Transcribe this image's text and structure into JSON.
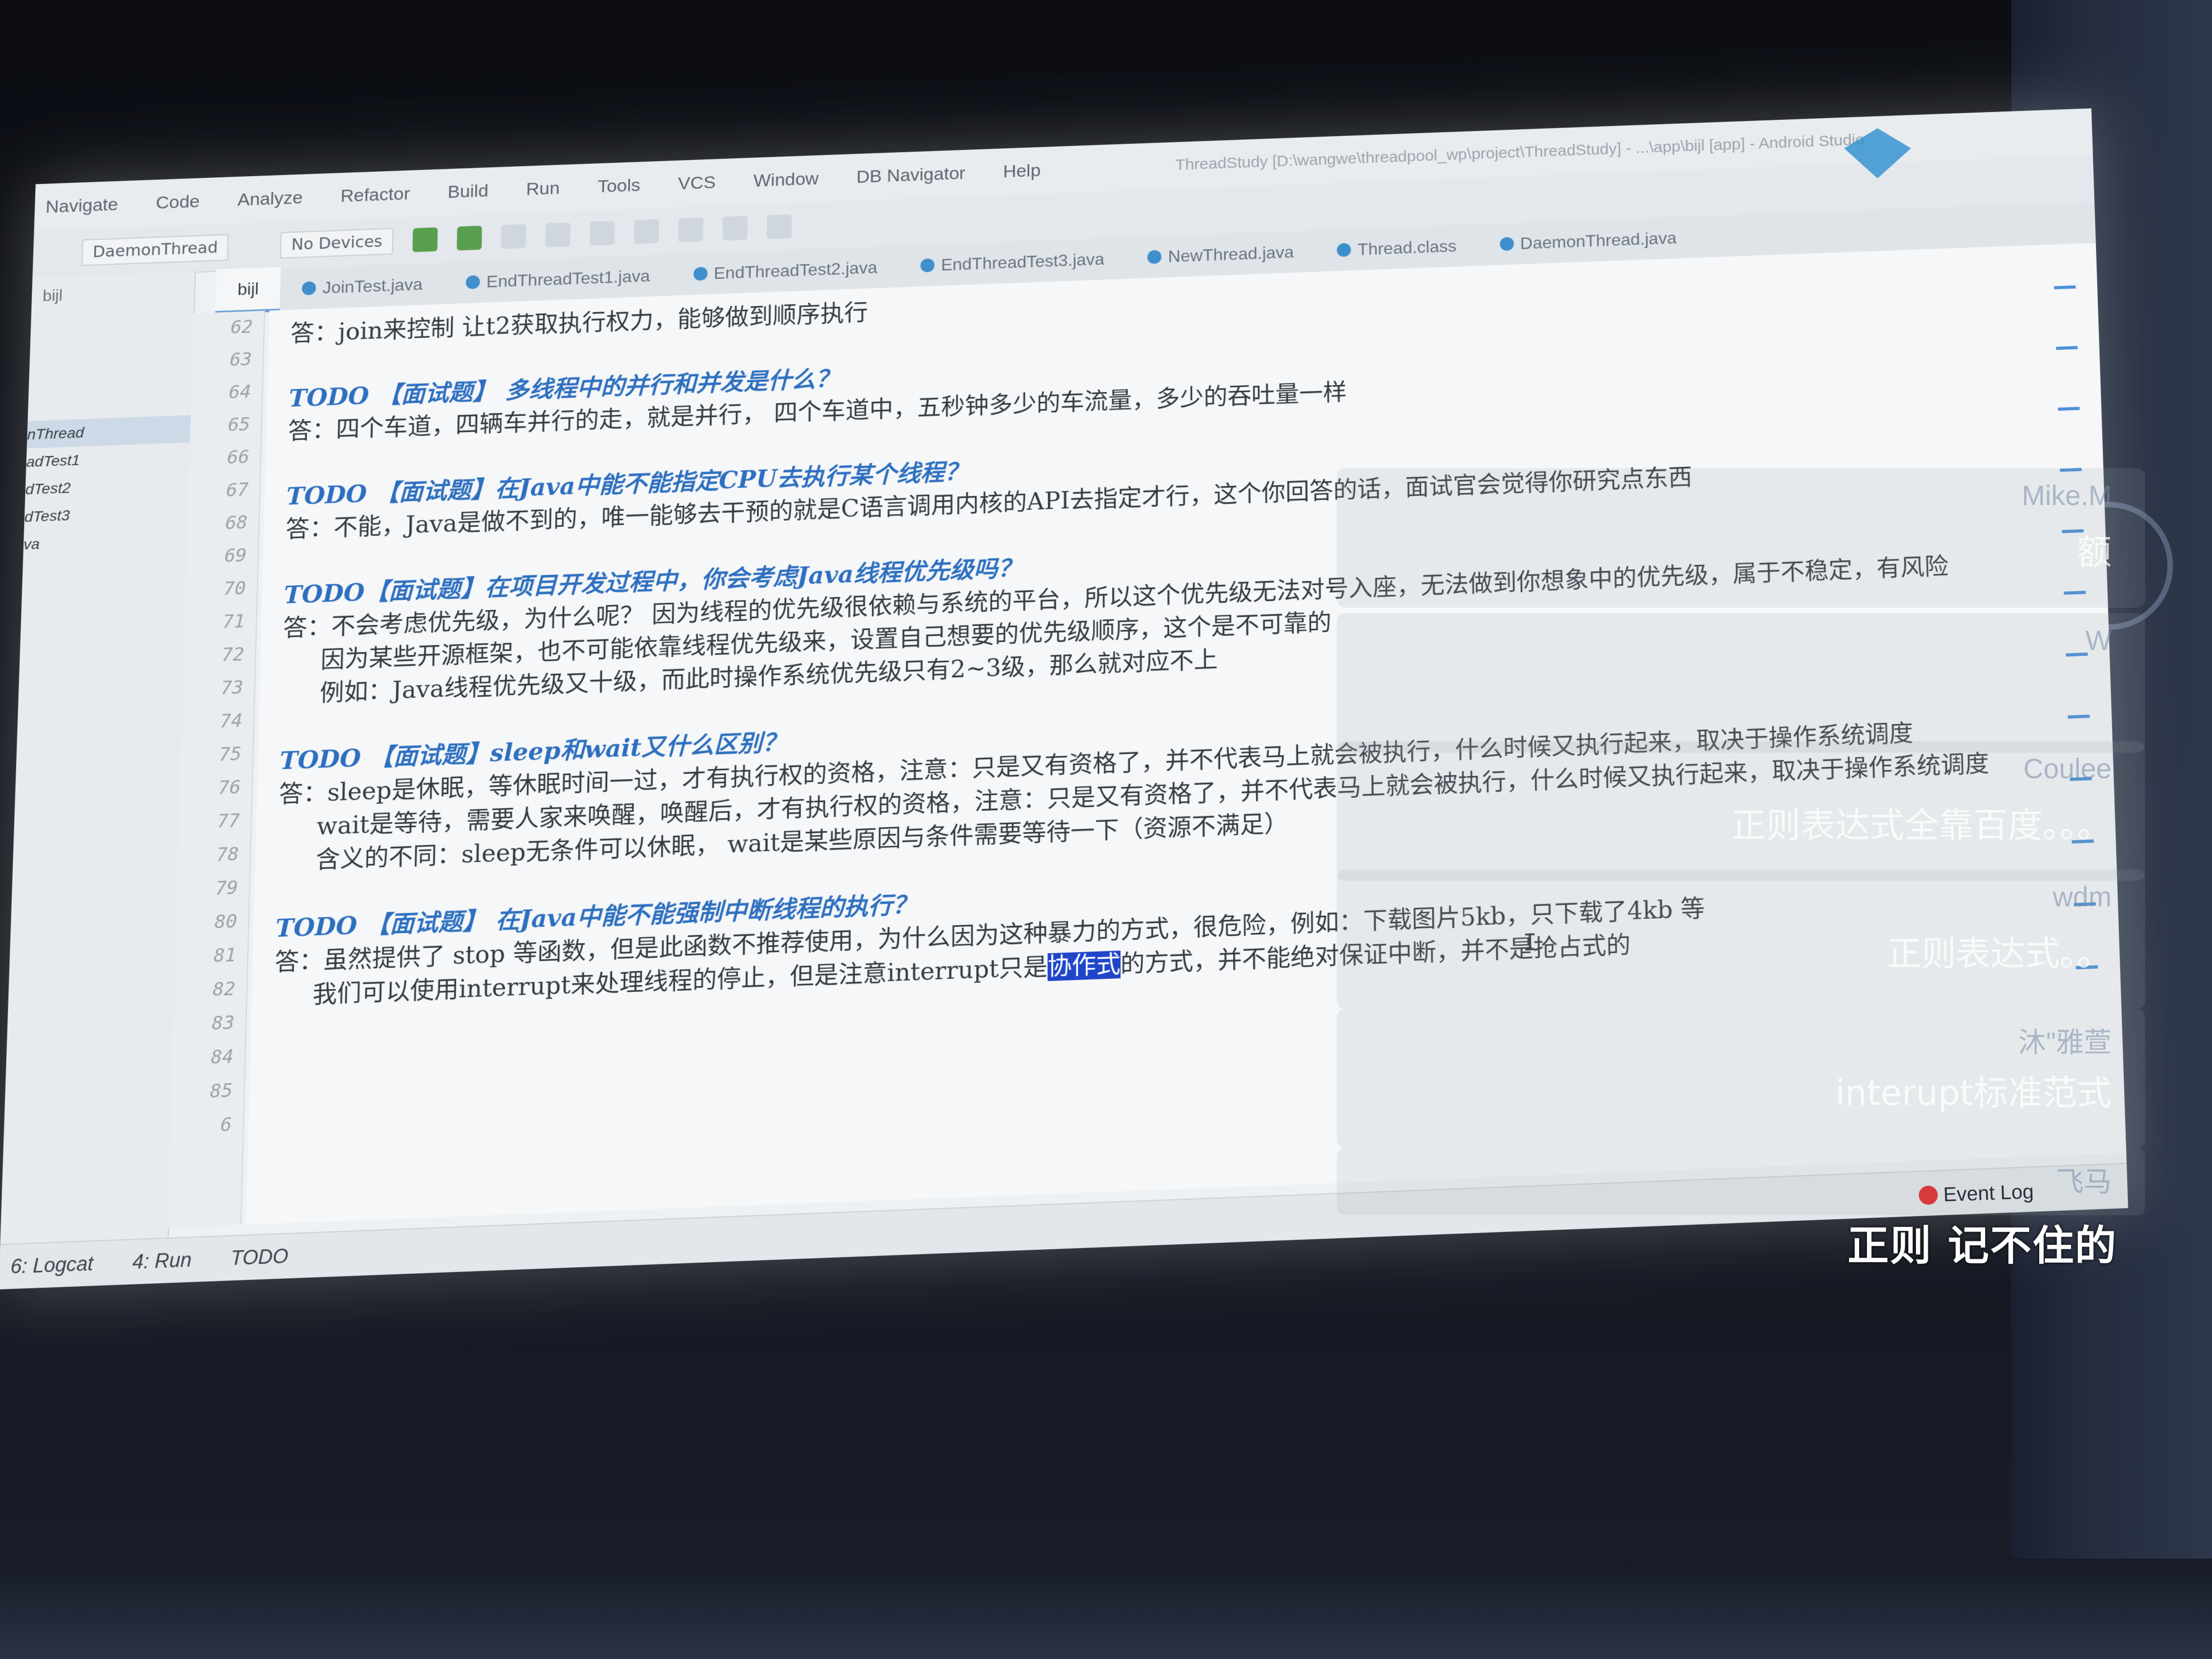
{
  "window": {
    "title": "ThreadStudy [D:\\wangwe\\threadpool_wp\\project\\ThreadStudy] - ...\\app\\bijl [app] - Android Studio"
  },
  "menu": [
    "Navigate",
    "Code",
    "Analyze",
    "Refactor",
    "Build",
    "Run",
    "Tools",
    "VCS",
    "Window",
    "DB Navigator",
    "Help"
  ],
  "toolbar": {
    "run_config": "DaemonThread",
    "devices": "No Devices"
  },
  "tabs": [
    {
      "label": "bijl",
      "active": true
    },
    {
      "label": "JoinTest.java"
    },
    {
      "label": "EndThreadTest1.java"
    },
    {
      "label": "EndThreadTest2.java"
    },
    {
      "label": "EndThreadTest3.java"
    },
    {
      "label": "NewThread.java"
    },
    {
      "label": "Thread.class"
    },
    {
      "label": "DaemonThread.java"
    }
  ],
  "project_panel": {
    "header": "bijl",
    "items": [
      "nThread",
      "adTest1",
      "dTest2",
      "dTest3",
      "va"
    ]
  },
  "editor": {
    "line_numbers": [
      "62",
      "63",
      "64",
      "65",
      "66",
      "67",
      "68",
      "69",
      "70",
      "71",
      "72",
      "73",
      "74",
      "75",
      "76",
      "77",
      "78",
      "79",
      "80",
      "81",
      "82",
      "83",
      "84",
      "85",
      "6"
    ],
    "lines": [
      {
        "ln": "62",
        "text": "答：join来控制 让t2获取执行权力，能够做到顺序执行"
      },
      {
        "ln": "64",
        "todo": "TODO 【面试题】 多线程中的并行和并发是什么？"
      },
      {
        "ln": "65",
        "text": "答：四个车道，四辆车并行的走，就是并行，     四个车道中，五秒钟多少的车流量，多少的吞吐量一样"
      },
      {
        "ln": "67",
        "todo": "TODO 【面试题】在Java中能不能指定CPU去执行某个线程？"
      },
      {
        "ln": "68",
        "text": "答：不能，Java是做不到的，唯一能够去干预的就是C语言调用内核的API去指定才行，这个你回答的话，面试官会觉得你研究点东西"
      },
      {
        "ln": "70",
        "todo": "TODO【面试题】在项目开发过程中，你会考虑Java线程优先级吗？"
      },
      {
        "ln": "71",
        "text": "答：不会考虑优先级，为什么呢？ 因为线程的优先级很依赖与系统的平台，所以这个优先级无法对号入座，无法做到你想象中的优先级，属于不稳定，有风险"
      },
      {
        "ln": "72",
        "text": "因为某些开源框架，也不可能依靠线程优先级来，设置自己想要的优先级顺序，这个是不可靠的"
      },
      {
        "ln": "73",
        "text": "例如：Java线程优先级又十级，而此时操作系统优先级只有2~3级，那么就对应不上"
      },
      {
        "ln": "75",
        "todo": "TODO 【面试题】sleep和wait又什么区别？"
      },
      {
        "ln": "76",
        "text": "答：sleep是休眠，等休眠时间一过，才有执行权的资格，注意：只是又有资格了，并不代表马上就会被执行，什么时候又执行起来，取决于操作系统调度"
      },
      {
        "ln": "77",
        "text": "wait是等待，需要人家来唤醒，唤醒后，才有执行权的资格，注意：只是又有资格了，并不代表马上就会被执行，什么时候又执行起来，取决于操作系统调度"
      },
      {
        "ln": "78",
        "text": "含义的不同：sleep无条件可以休眠， wait是某些原因与条件需要等待一下（资源不满足）"
      },
      {
        "ln": "80",
        "todo": "TODO 【面试题】 在Java中能不能强制中断线程的执行？"
      },
      {
        "ln": "81",
        "text": "答：虽然提供了 stop 等函数，但是此函数不推荐使用，为什么因为这种暴力的方式，很危险，例如：下载图片5kb，只下载了4kb 等"
      },
      {
        "ln": "82",
        "pre": "我们可以使用interrupt来处理线程的停止，但是注意interrupt只是",
        "sel": "协作式",
        "post": "的方式，并不能绝对保证中断，并不是抢占式的"
      }
    ]
  },
  "danmaku": [
    {
      "user": "Mike.M",
      "msg": "额"
    },
    {
      "user": "W",
      "msg": ""
    },
    {
      "user": "Coulee",
      "msg": "正则表达式全靠百度。。。"
    },
    {
      "user": "wdm",
      "msg": "正则表达式。。"
    },
    {
      "user": "沐\"雅萱",
      "msg": "interupt标准范式"
    },
    {
      "user": "飞马",
      "msg": ""
    }
  ],
  "status_bar": {
    "logcat": "6: Logcat",
    "run": "4: Run",
    "todo": "TODO",
    "event_log": "Event Log"
  },
  "caption": "正则 记不住的",
  "colors": {
    "todo": "#2d6fc0",
    "selection": "#1f46c9",
    "editor_bg": "#f6f7f8"
  }
}
